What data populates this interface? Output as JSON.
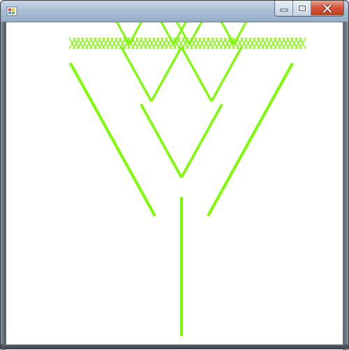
{
  "window": {
    "title": "",
    "icon": "app-icon",
    "buttons": [
      {
        "name": "minimize-icon"
      },
      {
        "name": "maximize-icon"
      },
      {
        "name": "close-icon"
      }
    ]
  },
  "drawing": {
    "type": "fractal-tree",
    "stroke_color": "#7cfc00",
    "background": "#ffffff",
    "depth": 10,
    "branch_angle_deg": 25,
    "length_ratio": 0.78
  }
}
